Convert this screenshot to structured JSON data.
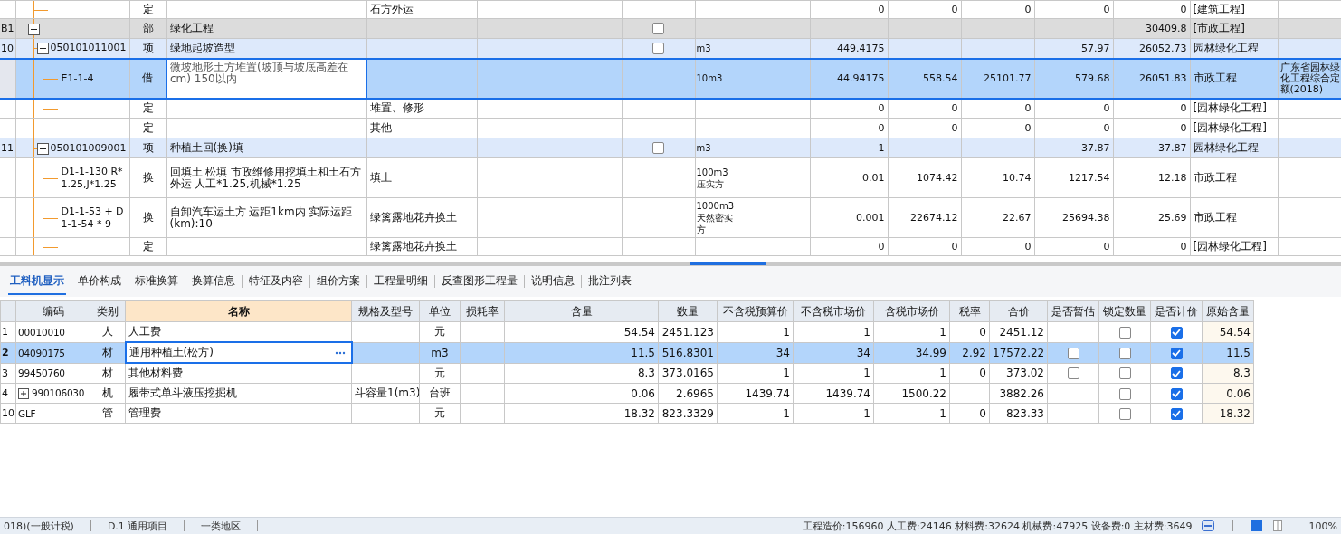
{
  "estimate": {
    "rows": [
      {
        "kind": "norm",
        "type": "定",
        "feature": "石方外运",
        "column_9": "0",
        "column_10": "0",
        "column_11": "0",
        "column_12": "0",
        "column_13": "0",
        "specialty": "[建筑工程]",
        "selected": false
      },
      {
        "kind": "division",
        "no": "B1",
        "type": "部",
        "name": "绿化工程",
        "checked": false,
        "column_13": "30409.8",
        "specialty": "[市政工程]",
        "expanded": true,
        "selected": false,
        "children": [
          {
            "kind": "bill",
            "no": "10",
            "code": "050101011001",
            "type": "项",
            "name": "绿地起坡造型",
            "unit": "m3",
            "checked": false,
            "column_9": "449.4175",
            "column_12": "57.97",
            "column_13": "26052.73",
            "specialty": "园林绿化工程",
            "expanded": true,
            "selected": false,
            "children": [
              {
                "kind": "norm",
                "code": "E1-1-4",
                "type": "借",
                "name": "微坡地形土方堆置(坡顶与坡底高差在cm) 150以内",
                "unit": "10m3",
                "column_9": "44.94175",
                "column_10": "558.54",
                "column_11": "25101.77",
                "column_12": "579.68",
                "column_13": "26051.83",
                "specialty": "市政工程",
                "source": "广东省园林绿化工程综合定额(2018)",
                "selected": true
              },
              {
                "kind": "norm",
                "type": "定",
                "feature": "堆置、修形",
                "column_9": "0",
                "column_10": "0",
                "column_11": "0",
                "column_12": "0",
                "column_13": "0",
                "specialty": "[园林绿化工程]",
                "selected": false
              },
              {
                "kind": "norm",
                "type": "定",
                "feature": "其他",
                "column_9": "0",
                "column_10": "0",
                "column_11": "0",
                "column_12": "0",
                "column_13": "0",
                "specialty": "[园林绿化工程]",
                "selected": false
              }
            ]
          },
          {
            "kind": "bill",
            "no": "11",
            "code": "050101009001",
            "type": "项",
            "name": "种植土回(换)填",
            "unit": "m3",
            "checked": false,
            "column_9": "1",
            "column_12": "37.87",
            "column_13": "37.87",
            "specialty": "园林绿化工程",
            "expanded": true,
            "selected": false,
            "children": [
              {
                "kind": "norm",
                "code": "D1-1-130 R*1.25,J*1.25",
                "type": "换",
                "name": "回填土 松填  市政维修用挖填土和土石方外运 人工*1.25,机械*1.25",
                "feature": "填土",
                "unit": "100m3压实方",
                "column_9": "0.01",
                "column_10": "1074.42",
                "column_11": "10.74",
                "column_12": "1217.54",
                "column_13": "12.18",
                "specialty": "市政工程",
                "selected": false
              },
              {
                "kind": "norm",
                "code": "D1-1-53 + D1-1-54 * 9",
                "type": "换",
                "name": "自卸汽车运土方 运距1km内  实际运距(km):10",
                "feature": "绿篱露地花卉换土",
                "unit": "1000m3天然密实方",
                "column_9": "0.001",
                "column_10": "22674.12",
                "column_11": "22.67",
                "column_12": "25694.38",
                "column_13": "25.69",
                "specialty": "市政工程",
                "selected": false
              },
              {
                "kind": "norm",
                "type": "定",
                "feature": "绿篱露地花卉换土",
                "column_9": "0",
                "column_10": "0",
                "column_11": "0",
                "column_12": "0",
                "column_13": "0",
                "specialty": "[园林绿化工程]",
                "selected": false
              }
            ]
          }
        ]
      }
    ]
  },
  "tabs": [
    {
      "label": "工料机显示",
      "selected": true
    },
    {
      "label": "单价构成",
      "selected": false
    },
    {
      "label": "标准换算",
      "selected": false
    },
    {
      "label": "换算信息",
      "selected": false
    },
    {
      "label": "特征及内容",
      "selected": false
    },
    {
      "label": "组价方案",
      "selected": false
    },
    {
      "label": "工程量明细",
      "selected": false
    },
    {
      "label": "反查图形工程量",
      "selected": false
    },
    {
      "label": "说明信息",
      "selected": false
    },
    {
      "label": "批注列表",
      "selected": false
    }
  ],
  "resources": {
    "columns": [
      "编码",
      "类别",
      "名称",
      "规格及型号",
      "单位",
      "损耗率",
      "含量",
      "数量",
      "不含税预算价",
      "不含税市场价",
      "含税市场价",
      "税率",
      "合价",
      "是否暂估",
      "锁定数量",
      "是否计价",
      "原始含量"
    ],
    "rows": [
      {
        "no": "1",
        "code": "00010010",
        "category": "人",
        "name": "人工费",
        "unit": "元",
        "content": "54.54",
        "quantity": "2451.123",
        "budget_price": "1",
        "market_price": "1",
        "tax_market_price": "1",
        "tax_rate": "0",
        "total": "2451.12",
        "locked": false,
        "priced": true,
        "original_content": "54.54",
        "selected": false
      },
      {
        "no": "2",
        "code": "04090175",
        "category": "材",
        "name": "通用种植土(松方)",
        "unit": "m3",
        "content": "11.5",
        "quantity": "516.8301",
        "budget_price": "34",
        "market_price": "34",
        "tax_market_price": "34.99",
        "tax_rate": "2.92",
        "total": "17572.22",
        "provisional": false,
        "locked": false,
        "priced": true,
        "original_content": "11.5",
        "selected": true
      },
      {
        "no": "3",
        "code": "99450760",
        "category": "材",
        "name": "其他材料费",
        "unit": "元",
        "content": "8.3",
        "quantity": "373.0165",
        "budget_price": "1",
        "market_price": "1",
        "tax_market_price": "1",
        "tax_rate": "0",
        "total": "373.02",
        "provisional": false,
        "locked": false,
        "priced": true,
        "original_content": "8.3",
        "selected": false
      },
      {
        "no": "4",
        "code": "990106030",
        "category": "机",
        "name": "履带式单斗液压挖掘机",
        "spec": "斗容量1(m3)",
        "unit": "台班",
        "content": "0.06",
        "quantity": "2.6965",
        "budget_price": "1439.74",
        "market_price": "1439.74",
        "tax_market_price": "1500.22",
        "total": "3882.26",
        "locked": false,
        "priced": true,
        "original_content": "0.06",
        "expanded": false,
        "selected": false
      },
      {
        "no": "10",
        "code": "GLF",
        "category": "管",
        "name": "管理费",
        "unit": "元",
        "content": "18.32",
        "quantity": "823.3329",
        "budget_price": "1",
        "market_price": "1",
        "tax_market_price": "1",
        "tax_rate": "0",
        "total": "823.33",
        "locked": false,
        "priced": true,
        "original_content": "18.32",
        "selected": false
      }
    ]
  },
  "status_bar": {
    "items": [
      "018)(一般计税)",
      "D.1 通用项目",
      "一类地区"
    ],
    "summary": "工程造价:156960  人工费:24146  材料费:32624  机械费:47925  设备费:0  主材费:3649",
    "zoom": "100%"
  }
}
